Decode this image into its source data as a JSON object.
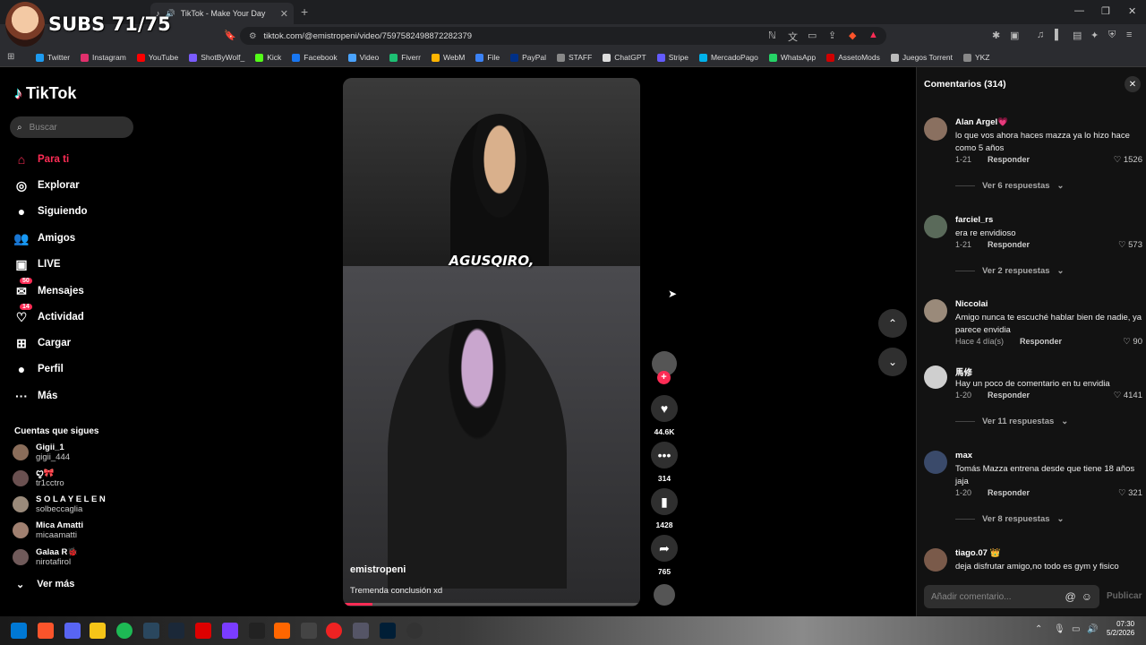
{
  "browser": {
    "tab_title": "TikTok - Make Your Day",
    "url": "tiktok.com/@emistropeni/video/7597582498872282379",
    "overlay_text": "SUBS 71/75",
    "bookmarks": [
      "Twitter",
      "Instagram",
      "YouTube",
      "ShotByWolf_",
      "Kick",
      "Facebook",
      "Video",
      "Fiverr",
      "WebM",
      "File",
      "PayPal",
      "STAFF",
      "ChatGPT",
      "Stripe",
      "MercadoPago",
      "WhatsApp",
      "AssetoMods",
      "Juegos Torrent",
      "YKZ"
    ],
    "bookmark_colors": [
      "#1d9bf0",
      "#e1306c",
      "#ff0000",
      "#7b5cff",
      "#53fc18",
      "#1877f2",
      "#4aa3ff",
      "#1dbf73",
      "#ffb400",
      "#3b82f6",
      "#003087",
      "#888888",
      "#dddddd",
      "#635bff",
      "#00b1ea",
      "#25d366",
      "#d00000",
      "#bbbbbb",
      "#888888"
    ]
  },
  "sidebar": {
    "logo": "TikTok",
    "search_placeholder": "Buscar",
    "nav": [
      {
        "label": "Para ti",
        "icon": "home-icon"
      },
      {
        "label": "Explorar",
        "icon": "compass-icon"
      },
      {
        "label": "Siguiendo",
        "icon": "following-icon"
      },
      {
        "label": "Amigos",
        "icon": "friends-icon"
      },
      {
        "label": "LIVE",
        "icon": "live-icon"
      },
      {
        "label": "Mensajes",
        "icon": "messages-icon",
        "badge": "50"
      },
      {
        "label": "Actividad",
        "icon": "activity-icon",
        "badge": "14"
      },
      {
        "label": "Cargar",
        "icon": "upload-icon"
      },
      {
        "label": "Perfil",
        "icon": "profile-icon"
      },
      {
        "label": "Más",
        "icon": "more-icon"
      }
    ],
    "following_title": "Cuentas que sigues",
    "following": [
      {
        "name": "Gigii_1",
        "user": "gigii_444"
      },
      {
        "name": "ꨄ︎🎀",
        "user": "tr1cctro"
      },
      {
        "name": "S O L A Y E L E N",
        "user": "solbeccaglia"
      },
      {
        "name": "Mica Amatti",
        "user": "micaamatti"
      },
      {
        "name": "Galaa R🐞",
        "user": "nirotafirol"
      }
    ],
    "see_more": "Ver más"
  },
  "video": {
    "overlay_caption": "AGUSQIRO,",
    "author": "emistropeni",
    "description": "Tremenda conclusión xd",
    "progress": 0.1
  },
  "actions": {
    "likes": "44.6K",
    "comments": "314",
    "saves": "1428",
    "shares": "765"
  },
  "comments": {
    "title": "Comentarios",
    "count": "(314)",
    "items": [
      {
        "user": "Alan Argel💗",
        "text": "lo que vos ahora haces mazza ya lo hizo hace como 5 años",
        "date": "1-21",
        "reply": "Responder",
        "likes": "1526",
        "replies": "Ver 6 respuestas"
      },
      {
        "user": "farciel_rs",
        "text": "era re envidioso",
        "date": "1-21",
        "reply": "Responder",
        "likes": "573",
        "replies": "Ver 2 respuestas"
      },
      {
        "user": "Niccolai",
        "text": "Amigo nunca te escuché hablar bien de nadie, ya parece envidia",
        "date": "Hace 4 día(s)",
        "reply": "Responder",
        "likes": "90",
        "replies": ""
      },
      {
        "user": "馬修",
        "text": "Hay un poco de comentario en tu envidia",
        "date": "1-20",
        "reply": "Responder",
        "likes": "4141",
        "replies": "Ver 11 respuestas"
      },
      {
        "user": "max",
        "text": "Tomás Mazza entrena desde que tiene 18 años jaja",
        "date": "1-20",
        "reply": "Responder",
        "likes": "321",
        "replies": "Ver 8 respuestas"
      },
      {
        "user": "tiago.07 👑",
        "text": "deja disfrutar amigo,no todo es gym y fisico",
        "date": "",
        "reply": "",
        "likes": "",
        "replies": ""
      }
    ],
    "add_placeholder": "Añadir comentario...",
    "publish": "Publicar"
  },
  "taskbar": {
    "time": "07:30",
    "date": "5/2/2026"
  }
}
